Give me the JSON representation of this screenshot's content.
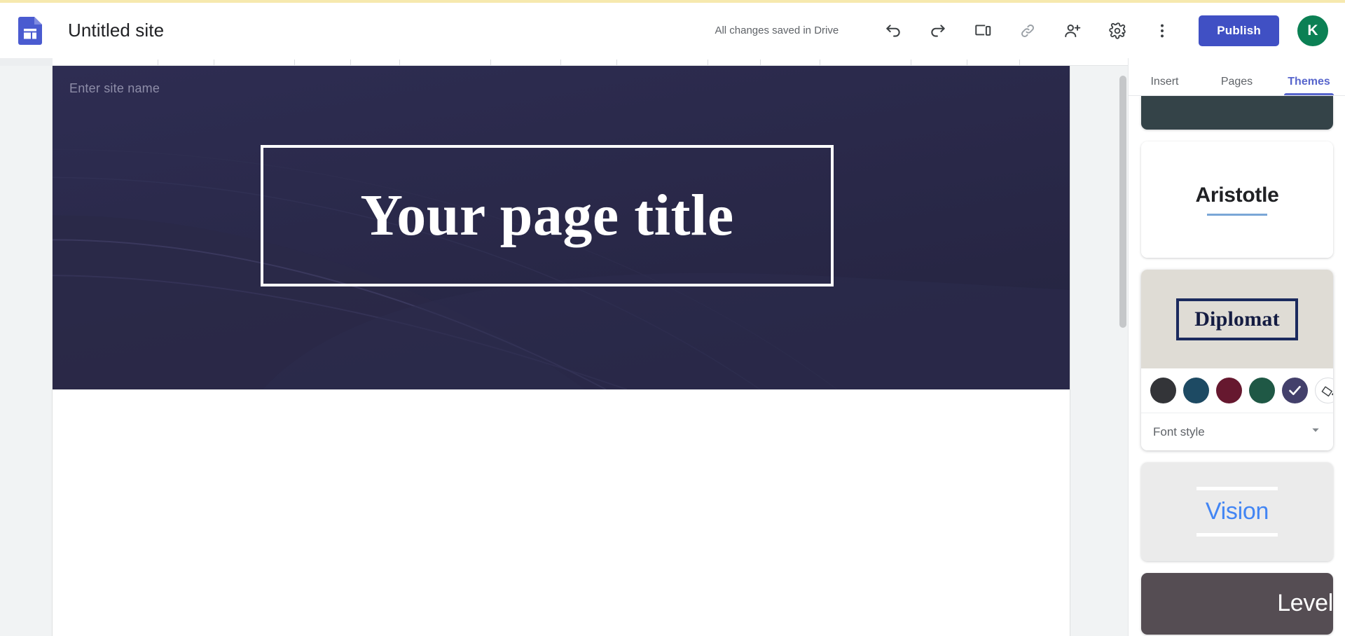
{
  "app": {
    "logo_icon": "google-sites-icon",
    "site_title": "Untitled site",
    "save_status": "All changes saved in Drive",
    "publish_label": "Publish",
    "avatar_initial": "K",
    "accent_color": "#4050c4",
    "avatar_color": "#0b8054"
  },
  "toolbar": {
    "icons": [
      {
        "name": "undo-icon",
        "tooltip": "Undo"
      },
      {
        "name": "redo-icon",
        "tooltip": "Redo"
      },
      {
        "name": "preview-icon",
        "tooltip": "Preview"
      },
      {
        "name": "copy-link-icon",
        "tooltip": "Copy published site link"
      },
      {
        "name": "add-editor-icon",
        "tooltip": "Share with others"
      },
      {
        "name": "settings-gear-icon",
        "tooltip": "Settings"
      },
      {
        "name": "more-options-icon",
        "tooltip": "More"
      }
    ]
  },
  "canvas": {
    "site_name_placeholder": "Enter site name",
    "page_title": "Your page title",
    "hero_background_color": "#2b2a4c",
    "title_border_color": "#ffffff"
  },
  "sidebar": {
    "tabs": [
      {
        "label": "Insert",
        "active": false
      },
      {
        "label": "Pages",
        "active": false
      },
      {
        "label": "Themes",
        "active": true
      }
    ],
    "active_tab_color": "#5765cc",
    "themes": [
      {
        "name": "",
        "preview_color": "#344348",
        "partial": true,
        "selected": false
      },
      {
        "name": "Aristotle",
        "preview_color": "#ffffff",
        "label_color": "#202124",
        "rule_color": "#7aa6d6",
        "selected": false
      },
      {
        "name": "Diplomat",
        "preview_color": "#dfdcd5",
        "label_color": "#141c42",
        "frame_color": "#1b2a5e",
        "selected": true,
        "colors": [
          {
            "name": "charcoal",
            "hex": "#333438",
            "selected": false
          },
          {
            "name": "teal-blue",
            "hex": "#1d4a63",
            "selected": false
          },
          {
            "name": "maroon",
            "hex": "#66182f",
            "selected": false
          },
          {
            "name": "forest-green",
            "hex": "#1f5845",
            "selected": false
          },
          {
            "name": "indigo",
            "hex": "#43406b",
            "selected": true
          }
        ],
        "custom_color_icon": "paint-bucket-icon",
        "font_style_label": "Font style",
        "font_style_caret_icon": "chevron-down-icon"
      },
      {
        "name": "Vision",
        "preview_color": "#ebebeb",
        "label_color": "#4285f4",
        "rule_color": "#ffffff",
        "selected": false
      },
      {
        "name": "Level",
        "preview_color": "#554d53",
        "label_color": "#ffffff",
        "selected": false
      }
    ]
  }
}
